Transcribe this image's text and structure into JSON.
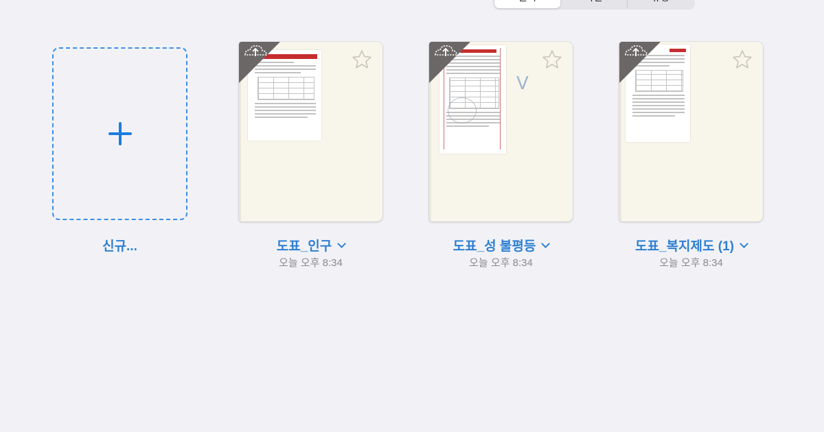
{
  "segmented": {
    "items": [
      "문서",
      "사진",
      "유형"
    ]
  },
  "new_doc": {
    "label": "신규..."
  },
  "notebooks": [
    {
      "title": "도표_인구",
      "date": "오늘 오후 8:34",
      "badge_icon": "cloud-upload-icon",
      "star_icon": "star-outline-icon"
    },
    {
      "title": "도표_성 불평등",
      "date": "오늘 오후 8:34",
      "badge_icon": "cloud-upload-icon",
      "star_icon": "star-outline-icon"
    },
    {
      "title": "도표_복지제도 (1)",
      "date": "오늘 오후 8:34",
      "badge_icon": "cloud-upload-icon",
      "star_icon": "star-outline-icon"
    }
  ],
  "colors": {
    "accent": "#2d7fd2",
    "background": "#f2f2f6",
    "notebook_cover": "#f8f6ea",
    "badge": "#6b6766",
    "thumb_red": "#c62d2d"
  }
}
